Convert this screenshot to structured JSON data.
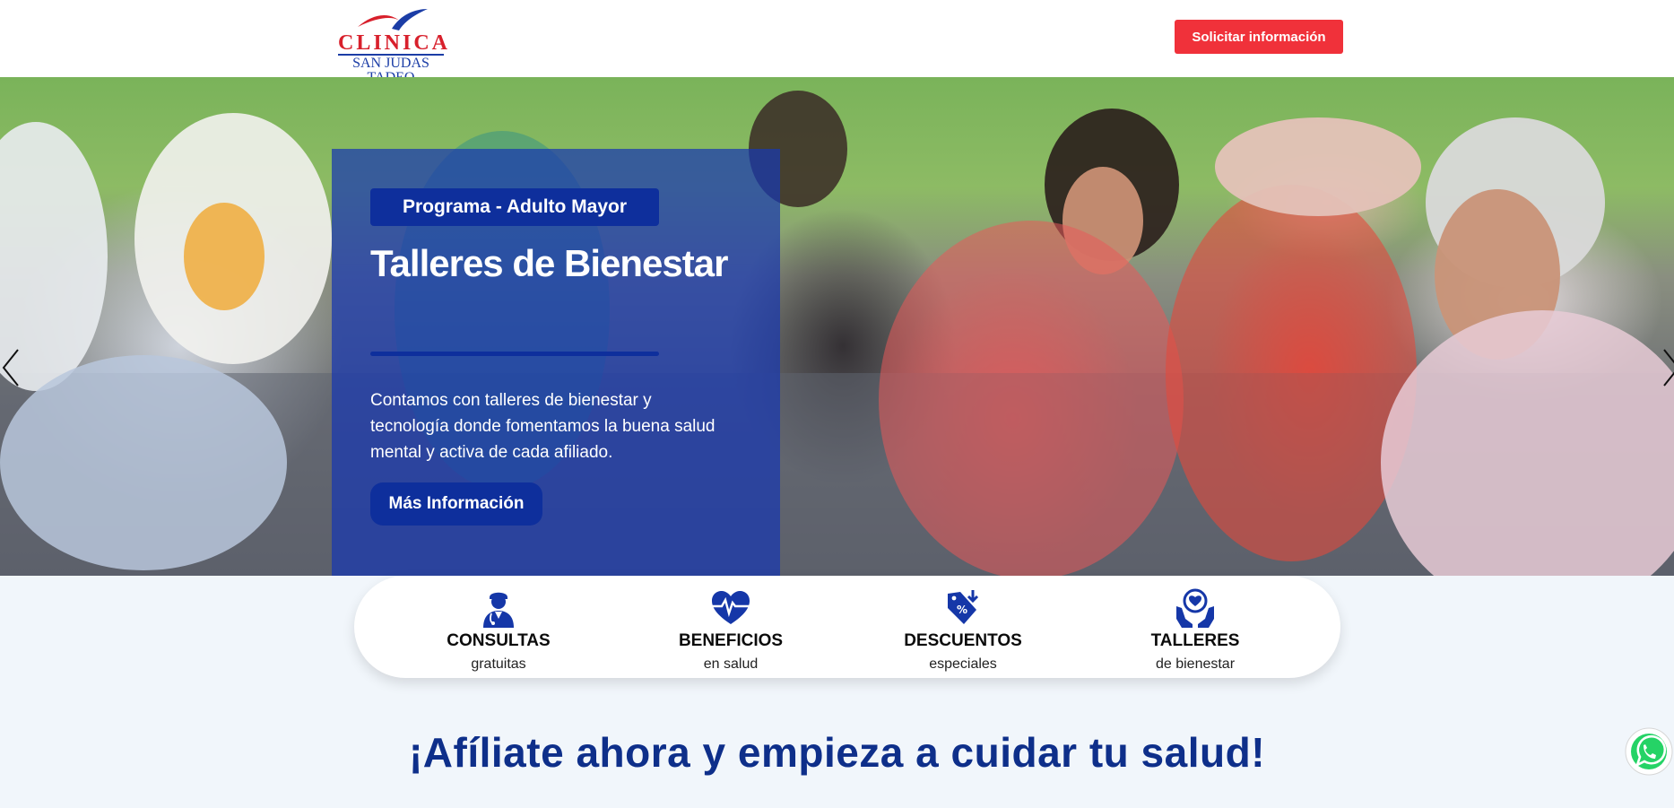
{
  "header": {
    "logo_line1": "CLINICA",
    "logo_line2": "SAN JUDAS TADEO",
    "cta_label": "Solicitar información"
  },
  "hero": {
    "tag": "Programa - Adulto Mayor",
    "title": "Talleres de Bienestar",
    "description": "Contamos con talleres de bienestar y tecnología donde fomentamos la buena salud mental y activa de cada afiliado.",
    "button_label": "Más Información"
  },
  "features": [
    {
      "icon": "doctor-icon",
      "title": "CONSULTAS",
      "subtitle": "gratuitas"
    },
    {
      "icon": "heartbeat-icon",
      "title": "BENEFICIOS",
      "subtitle": "en salud"
    },
    {
      "icon": "discount-tag-icon",
      "title": "DESCUENTOS",
      "subtitle": "especiales"
    },
    {
      "icon": "care-hands-icon",
      "title": "TALLERES",
      "subtitle": "de bienestar"
    }
  ],
  "cta_heading": "¡Afíliate ahora y empieza a cuidar tu salud!",
  "colors": {
    "brand_blue": "#0e2f9c",
    "heading_blue": "#0e2f8a",
    "cta_red": "#f0313a",
    "logo_red": "#d8202c",
    "page_bg": "#f1f6fb",
    "whatsapp_green": "#25d366"
  }
}
